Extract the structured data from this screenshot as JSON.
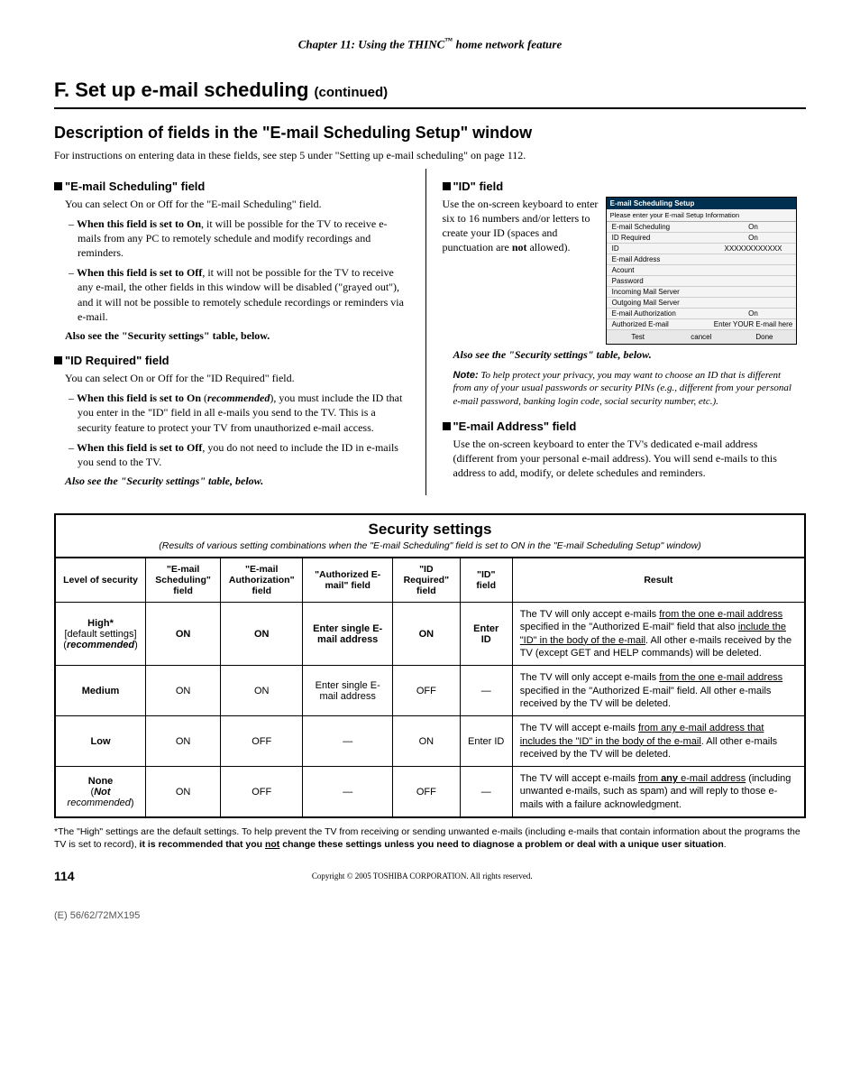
{
  "chapter_header_prefix": "Chapter 11: Using the THINC",
  "chapter_header_suffix": " home network feature",
  "h1_prefix": "F.  Set up e-mail scheduling ",
  "h1_suffix": "(continued)",
  "h2": "Description of fields in the \"E-mail Scheduling Setup\" window",
  "intro": "For instructions on entering data in these fields, see step 5 under \"Setting up e-mail scheduling\" on page 112.",
  "left": {
    "field1_heading": "\"E-mail Scheduling\" field",
    "field1_intro": "You can select On or Off for the \"E-mail Scheduling\" field.",
    "field1_li1_a": "When this field is set to On",
    "field1_li1_b": ", it will be possible for the TV to receive e-mails from any PC to remotely schedule and modify recordings and reminders.",
    "field1_li2_a": "When this field is set to Off",
    "field1_li2_b": ", it will not be possible for the TV to receive any e-mail, the other fields in this window will be disabled (\"grayed out\"), and it will not be possible to remotely schedule recordings or reminders via e-mail.",
    "also_see1": "Also see the \"Security settings\" table, below.",
    "field2_heading": "\"ID Required\" field",
    "field2_intro": "You can select On or Off for the \"ID Required\" field.",
    "field2_li1_a": "When this field is set to On",
    "field2_li1_b": " (",
    "field2_li1_c": "recommended",
    "field2_li1_d": "), you must include the ID that you enter in the \"ID\" field in all e-mails you send to the TV. This is a security feature to protect your TV from unauthorized e-mail access.",
    "field2_li2_a": "When this field is set to Off",
    "field2_li2_b": ", you do not need to include the ID in e-mails you send to the TV.",
    "also_see2": "Also see the \"Security settings\" table, below."
  },
  "right": {
    "field1_heading": "\"ID\" field",
    "field1_text_a": "Use the on-screen keyboard to enter six to 16 numbers and/or letters to create your ID (spaces and punctuation are ",
    "field1_text_b": "not",
    "field1_text_c": " allowed).",
    "panel": {
      "title": "E-mail Scheduling Setup",
      "subhead": "Please enter your E-mail Setup Information",
      "rows": [
        {
          "label": "E-mail Scheduling",
          "val": "On"
        },
        {
          "label": "ID Required",
          "val": "On"
        },
        {
          "label": "ID",
          "val": "XXXXXXXXXXXX"
        },
        {
          "label": "E-mail Address",
          "val": ""
        },
        {
          "label": "Acount",
          "val": ""
        },
        {
          "label": "Password",
          "val": ""
        },
        {
          "label": "Incoming Mail Server",
          "val": ""
        },
        {
          "label": "Outgoing Mail Server",
          "val": ""
        },
        {
          "label": "E-mail Authorization",
          "val": "On"
        },
        {
          "label": "Authorized E-mail",
          "val": "Enter YOUR E-mail here"
        }
      ],
      "buttons": [
        "Test",
        "cancel",
        "Done"
      ]
    },
    "also_see": "Also see the \"Security settings\" table, below.",
    "note_label": "Note:",
    "note_text": " To help protect your privacy, you may want to choose an ID that is different from any of your usual passwords or security PINs (e.g., different from your personal e-mail password, banking login code, social security number, etc.).",
    "field2_heading": "\"E-mail Address\" field",
    "field2_text": "Use the on-screen keyboard to enter the TV's dedicated e-mail address (different from your personal e-mail address). You will send e-mails to this address to add, modify, or delete schedules and reminders."
  },
  "table": {
    "title": "Security settings",
    "subtitle": "(Results of various setting combinations when the \"E-mail Scheduling\" field is set to ON in the \"E-mail Scheduling Setup\" window)",
    "headers": [
      "Level of security",
      "\"E-mail Scheduling\" field",
      "\"E-mail Authorization\" field",
      "\"Authorized E-mail\" field",
      "\"ID Required\" field",
      "\"ID\" field",
      "Result"
    ],
    "rows": [
      {
        "level_a": "High*",
        "level_b": "[default settings]",
        "level_c": "recommended",
        "c1": "ON",
        "c2": "ON",
        "c3": "Enter single E-mail address",
        "c4": "ON",
        "c5": "Enter ID",
        "result_parts": [
          "The TV will only accept e-mails ",
          "from the one e-mail address",
          " specified in the \"Authorized E-mail\" field that also ",
          "include the \"ID\" in the body of the e-mail",
          ". All other e-mails received by the TV (except GET and HELP commands) will be deleted."
        ]
      },
      {
        "level_a": "Medium",
        "level_b": "",
        "level_c": "",
        "c1": "ON",
        "c2": "ON",
        "c3": "Enter single E-mail address",
        "c4": "OFF",
        "c5": "—",
        "result_parts": [
          "The TV will only accept e-mails ",
          "from the one e-mail address",
          " specified in the \"Authorized E-mail\" field. All other e-mails received by the TV will be deleted."
        ]
      },
      {
        "level_a": "Low",
        "level_b": "",
        "level_c": "",
        "c1": "ON",
        "c2": "OFF",
        "c3": "—",
        "c4": "ON",
        "c5": "Enter ID",
        "result_parts": [
          "The TV will accept e-mails ",
          "from any e-mail address that includes the \"ID\" in the body of the e-mail",
          ". All other e-mails received by the TV will be deleted."
        ]
      },
      {
        "level_a": "None",
        "level_b_bold": "Not",
        "level_b_rest": " recommended",
        "level_c": "",
        "c1": "ON",
        "c2": "OFF",
        "c3": "—",
        "c4": "OFF",
        "c5": "—",
        "result_parts": [
          "The TV will accept e-mails ",
          "from ",
          "any",
          " e-mail address",
          " (including unwanted e-mails, such as spam) and will reply to those e-mails with a failure acknowledgment."
        ]
      }
    ]
  },
  "footnote_a": "*The \"High\" settings are the default settings. To help prevent the TV from receiving or sending unwanted e-mails (including e-mails that contain information about the programs the TV is set to record), ",
  "footnote_b": "it is recommended that you ",
  "footnote_c": "not",
  "footnote_d": " change these settings unless you need to diagnose a problem or deal with a unique user situation",
  "footnote_e": ".",
  "page_num": "114",
  "copyright": "Copyright © 2005 TOSHIBA CORPORATION. All rights reserved.",
  "bottom_code": "(E) 56/62/72MX195"
}
